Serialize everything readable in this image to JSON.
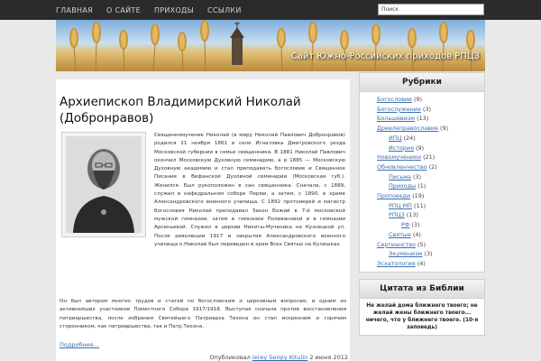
{
  "nav": {
    "items": [
      "ГЛАВНАЯ",
      "О САЙТЕ",
      "ПРИХОДЫ",
      "ССЫЛКИ"
    ]
  },
  "search": {
    "value": "Поиск"
  },
  "header": {
    "site_title": "Сайт Южно-Российских приходов РПЦЗ"
  },
  "post": {
    "title": "Архиепископ Владимирский Николай (Добронравов)",
    "body_top": "Священномученик Николай (в миру Николай Павлович Добронравов) родился 21 ноября 1861 в селе Игнатовка Дмитровского уезда Московской губернии в семье священника. В 1881 Николай Павлович окончил Московскую Духовную семинарию, а в 1885 — Московскую Духовную академию и стал преподавать богословие и Священное Писание в Вифанской Духовной семинарии (Московская губ.). Женился. Был рукоположен в сан священника. Сначала, с 1889, служил в кафедральном соборе Перми, а затем, с 1890, в храме Александровского военного училища. С 1892 протоиерей и магистр богословия Николай преподавал Закон Божий в 7-й московской мужской гимназии, затем в гимназии Поливановой и в гимназии Арсеньевой. Служил в церкви Никиты-Мученика на Кузнецкой ул. После революции 1917 и закрытия Александровского военного училища о.Николай был переведен в храм Всех Святых на Кулишках.",
    "body_bottom": "Он был автором многих трудов и статей по богословским и церковным вопросам, и одним из активнейших участников Поместного Собора 1917/1918. Выступая сначала против восстановления патриаршества, после избрания Святейшего Патриарха Тихона он стал искренним и горячим сторонником, как патриаршества, так и Патр.Тихона.",
    "more": "Подробнее...",
    "byline_prefix": "Опубликовал",
    "author": "Ierey Sergiy Kitulin",
    "date": "2 июня 2012"
  },
  "sidebar": {
    "rubrics_title": "Рубрики",
    "categories": [
      {
        "name": "Богословие",
        "count": "(9)",
        "level": 0
      },
      {
        "name": "Богослужение",
        "count": "(3)",
        "level": 0
      },
      {
        "name": "Большевизм",
        "count": "(13)",
        "level": 0
      },
      {
        "name": "Древлеправославие",
        "count": "(9)",
        "level": 0
      },
      {
        "name": "ИПЦ",
        "count": "(24)",
        "level": 1
      },
      {
        "name": "История",
        "count": "(9)",
        "level": 1
      },
      {
        "name": "Новомученики",
        "count": "(21)",
        "level": 0
      },
      {
        "name": "Обновленчество",
        "count": "(2)",
        "level": 0
      },
      {
        "name": "Письма",
        "count": "(3)",
        "level": 1
      },
      {
        "name": "Приходы",
        "count": "(1)",
        "level": 1
      },
      {
        "name": "Проповеди",
        "count": "(19)",
        "level": 0
      },
      {
        "name": "РПЦ МП",
        "count": "(11)",
        "level": 1
      },
      {
        "name": "РПЦЗ",
        "count": "(13)",
        "level": 1
      },
      {
        "name": "РФ",
        "count": "(3)",
        "level": 2
      },
      {
        "name": "Святые",
        "count": "(4)",
        "level": 1
      },
      {
        "name": "Сергианство",
        "count": "(5)",
        "level": 0
      },
      {
        "name": "Экуменизм",
        "count": "(3)",
        "level": 1
      },
      {
        "name": "Эсхатология",
        "count": "(4)",
        "level": 0
      }
    ],
    "quote_title": "Цитата из Библии",
    "quote_text": "Не желай дома ближнего твоего; не желай жены ближнего твоего... ничего, что у ближнего твоего. (10-я заповедь)"
  }
}
